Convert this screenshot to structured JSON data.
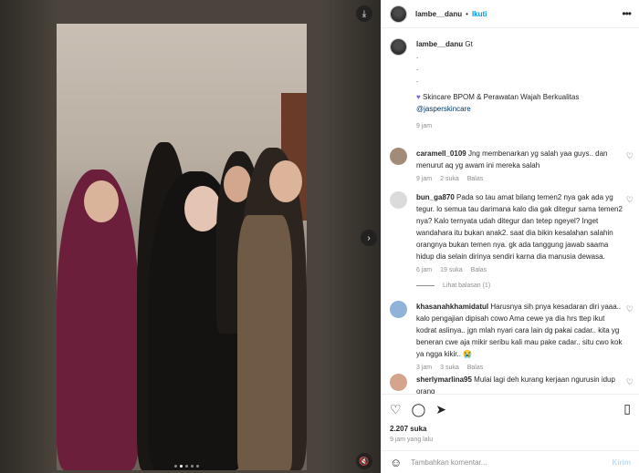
{
  "post": {
    "username": "lambe__danu",
    "follow_label": "Ikuti",
    "separator": "•",
    "more_icon": "more-horizontal-icon"
  },
  "caption": {
    "username": "lambe__danu",
    "text": "Gt",
    "dots": [
      ".",
      ".",
      "."
    ],
    "promo_text": "Skincare BPOM & Perawatan Wajah Berkualitas",
    "promo_link": "@jasperskincare",
    "time": "9 jam"
  },
  "comments": [
    {
      "username": "caramell_0109",
      "text": "Jng membenarkan yg salah yaa guys.. dan menurut aq yg awam ini mereka salah",
      "time": "9 jam",
      "likes": "2 suka",
      "reply": "Balas",
      "avatar_color": "#a38b7a"
    },
    {
      "username": "bun_ga870",
      "text": "Pada so tau amat bilang temen2 nya gak ada yg tegur. lo semua tau darimana kalo dia gak ditegur sama temen2 nya? Kalo ternyata udah ditegur dan tetep ngeyel? Inget wandahara itu bukan anak2. saat dia bikin kesalahan salahin orangnya bukan temen nya. gk ada tanggung jawab saama hidup dia selain dirinya sendiri karna dia manusia dewasa.",
      "time": "6 jam",
      "likes": "19 suka",
      "reply": "Balas",
      "view_replies": "Lihat balasan (1)",
      "avatar_color": "#dbdbdb"
    },
    {
      "username": "khasanahkhamidatul",
      "text": "Harusnya sih pnya kesadaran diri yaaa.. kalo pengajian dipisah cowo Ama cewe ya dia hrs ttep ikut kodrat aslinya.. jgn mlah nyari cara lain dg pakai cadar.. kita yg beneran cwe aja mikir seribu kali mau pake cadar.. situ cwo kok ya ngga kikir.. 😭",
      "time": "3 jam",
      "likes": "3 suka",
      "reply": "Balas",
      "avatar_color": "#8fb3d9"
    },
    {
      "username": "sherlymarlina95",
      "text": "Mulai lagi deh kurang kerjaan ngurusin idup orang",
      "avatar_color": "#d4a48c"
    }
  ],
  "footer": {
    "likes": "2.207 suka",
    "time": "9 jam yang lalu",
    "comment_placeholder": "Tambahkan komentar...",
    "post_label": "Kirim"
  },
  "media": {
    "page_dots": 5,
    "active_dot": 1
  },
  "colors": {
    "accent": "#0095f6",
    "link": "#00376b",
    "muted": "#8e8e8e"
  }
}
